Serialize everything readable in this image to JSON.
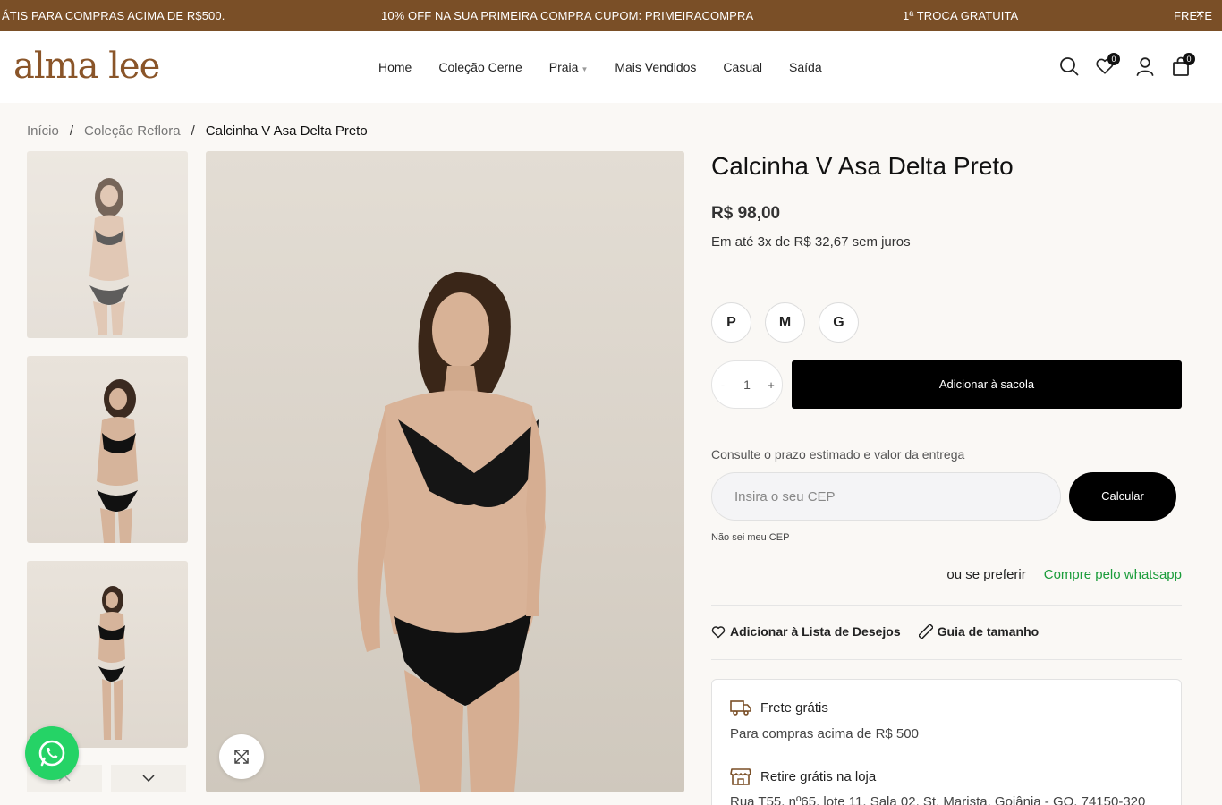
{
  "announcement": {
    "left": "ÁTIS PARA COMPRAS ACIMA DE R$500.",
    "center": "10% OFF NA SUA PRIMEIRA COMPRA CUPOM: PRIMEIRACOMPRA",
    "right": "1ª TROCA GRATUITA",
    "edge": "FRETE",
    "close_icon": "×"
  },
  "header": {
    "logo": "alma lee",
    "nav": [
      "Home",
      "Coleção Cerne",
      "Praia",
      "Mais Vendidos",
      "Casual",
      "Saída"
    ],
    "wishlist_count": "0",
    "cart_count": "0"
  },
  "breadcrumb": {
    "home": "Início",
    "collection": "Coleção Reflora",
    "current": "Calcinha V Asa Delta Preto",
    "separator": "/"
  },
  "product": {
    "title": "Calcinha V Asa Delta Preto",
    "price": "R$ 98,00",
    "installments": "Em até 3x de R$ 32,67 sem juros",
    "sizes": [
      "P",
      "M",
      "G"
    ],
    "qty_minus": "-",
    "quantity": "1",
    "qty_plus": "+",
    "add_to_bag": "Adicionar à sacola"
  },
  "shipping": {
    "label": "Consulte o prazo estimado e valor da entrega",
    "placeholder": "Insira o seu CEP",
    "calc_button": "Calcular",
    "no_cep": "Não sei meu CEP"
  },
  "whatsapp": {
    "prefix": "ou se preferir",
    "link": "Compre pelo whatsapp"
  },
  "actions": {
    "wishlist": "Adicionar à Lista de Desejos",
    "size_guide": "Guia de tamanho"
  },
  "info": {
    "shipping_title": "Frete grátis",
    "shipping_sub": "Para compras acima de R$ 500",
    "pickup_title": "Retire grátis na loja",
    "pickup_address": "Rua T55, nº65, lote 11, Sala 02, St. Marista, Goiânia - GO, 74150-320"
  },
  "colors": {
    "brand": "#7a4f27",
    "whatsapp_green": "#25d366",
    "link_green": "#1a9c3a"
  }
}
